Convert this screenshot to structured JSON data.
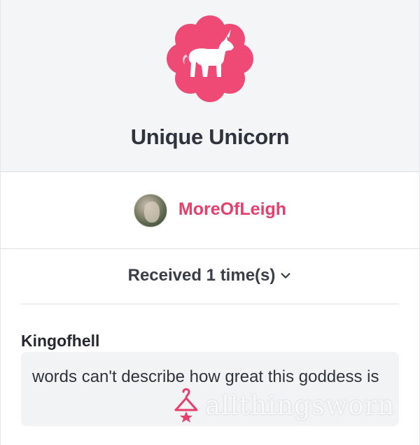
{
  "badge": {
    "title": "Unique Unicorn",
    "icon": "unicorn-icon",
    "color": "#ee4a75"
  },
  "giver": {
    "name": "MoreOfLeigh",
    "color": "#e83e6c"
  },
  "received": {
    "label": "Received 1 time(s)",
    "icon": "chevron-down-icon"
  },
  "comment": {
    "author": "Kingofhell",
    "text": "words can't describe how great this goddess is"
  },
  "watermark": {
    "text": "allthingsworn",
    "icon": "hanger-icon",
    "color": "#e83e6c"
  }
}
